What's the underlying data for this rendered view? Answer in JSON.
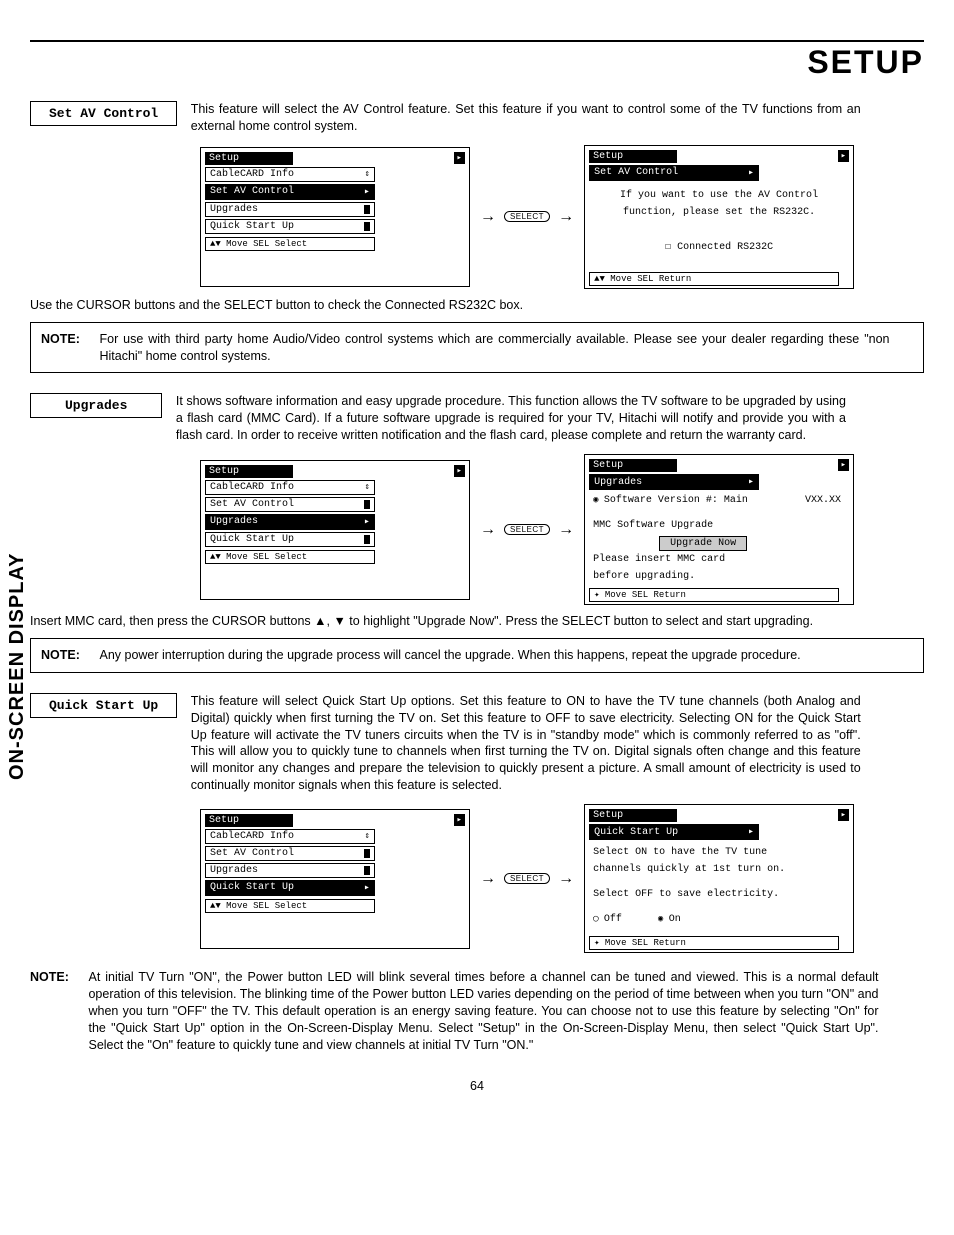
{
  "chapter_title": "SETUP",
  "sidebar": "ON-SCREEN DISPLAY",
  "page_number": "64",
  "select_btn": "SELECT",
  "av": {
    "box_label": "Set AV Control",
    "desc": "This feature will select the AV Control feature. Set this feature if you want to control some of the TV functions from an external home control system.",
    "after": "Use the CURSOR buttons and the SELECT button to check the Connected RS232C box.",
    "note": "For use with third party home Audio/Video control systems which are commercially available. Please see your dealer regarding these \"non Hitachi\" home control systems.",
    "menu_left": {
      "title": "Setup",
      "items": [
        "CableCARD Info",
        "Set AV Control",
        "Upgrades",
        "Quick Start Up"
      ],
      "highlight_index": 1,
      "hint": "▲▼ Move  SEL Select"
    },
    "menu_right": {
      "title": "Setup",
      "subtitle": "Set AV Control",
      "msg1": "If you want to use the AV Control",
      "msg2": "function, please set the RS232C.",
      "checkbox": "Connected RS232C",
      "hint": "▲▼ Move  SEL Return"
    }
  },
  "up": {
    "box_label": "Upgrades",
    "desc": "It shows software information and easy upgrade procedure. This function allows the TV software to be upgraded by using a flash card (MMC Card). If a future software upgrade is required for your TV, Hitachi will notify and provide you with a flash card. In order to receive written notification and the flash card, please complete and return the warranty card.",
    "after": "Insert MMC card, then press the CURSOR buttons ▲, ▼ to highlight \"Upgrade Now\". Press the SELECT button to select and start upgrading.",
    "note": "Any power interruption during the upgrade process will cancel the upgrade. When this happens, repeat the upgrade procedure.",
    "menu_left": {
      "title": "Setup",
      "items": [
        "CableCARD Info",
        "Set AV Control",
        "Upgrades",
        "Quick Start Up"
      ],
      "highlight_index": 2,
      "hint": "▲▼ Move  SEL Select"
    },
    "menu_right": {
      "title": "Setup",
      "subtitle": "Upgrades",
      "line1a": "Software Version #: Main",
      "line1b": "VXX.XX",
      "line2": "MMC Software Upgrade",
      "button": "Upgrade Now",
      "line3": "Please insert MMC card",
      "line4": "before upgrading.",
      "hint": "✦ Move  SEL Return"
    }
  },
  "qs": {
    "box_label": "Quick Start Up",
    "desc": "This feature will select Quick Start Up options. Set this feature to ON to have the TV tune channels (both Analog and Digital) quickly when first turning the TV on. Set this feature to OFF to save electricity. Selecting ON for the Quick Start Up feature will activate the TV tuners circuits when the TV is in \"standby mode\" which is commonly referred to as \"off\". This will allow you to quickly tune to channels when first turning the TV on. Digital signals often change and this feature will monitor any changes and prepare the television to quickly present a picture. A small amount of electricity is used to continually monitor signals when this feature is selected.",
    "note": "At initial TV Turn \"ON\", the Power button LED will blink several times before a channel can be tuned and viewed. This is a normal default operation of this television. The blinking time of the Power button LED varies depending on the period of time between when you turn \"ON\" and when you turn \"OFF\" the TV. This default operation is an energy saving feature. You can choose not to use this feature by selecting \"On\" for the \"Quick Start Up\" option in the On-Screen-Display Menu. Select \"Setup\" in the On-Screen-Display Menu, then select \"Quick Start Up\". Select the \"On\" feature to quickly tune and view channels at initial TV Turn \"ON.\"",
    "menu_left": {
      "title": "Setup",
      "items": [
        "CableCARD Info",
        "Set AV Control",
        "Upgrades",
        "Quick Start Up"
      ],
      "highlight_index": 3,
      "hint": "▲▼ Move  SEL Select"
    },
    "menu_right": {
      "title": "Setup",
      "subtitle": "Quick Start Up",
      "msg1": "Select ON to have the TV tune",
      "msg2": "channels quickly at 1st turn on.",
      "msg3": "Select OFF to save electricity.",
      "opt_off": "Off",
      "opt_on": "On",
      "hint": "✦ Move  SEL Return"
    }
  },
  "note_label": "NOTE:"
}
